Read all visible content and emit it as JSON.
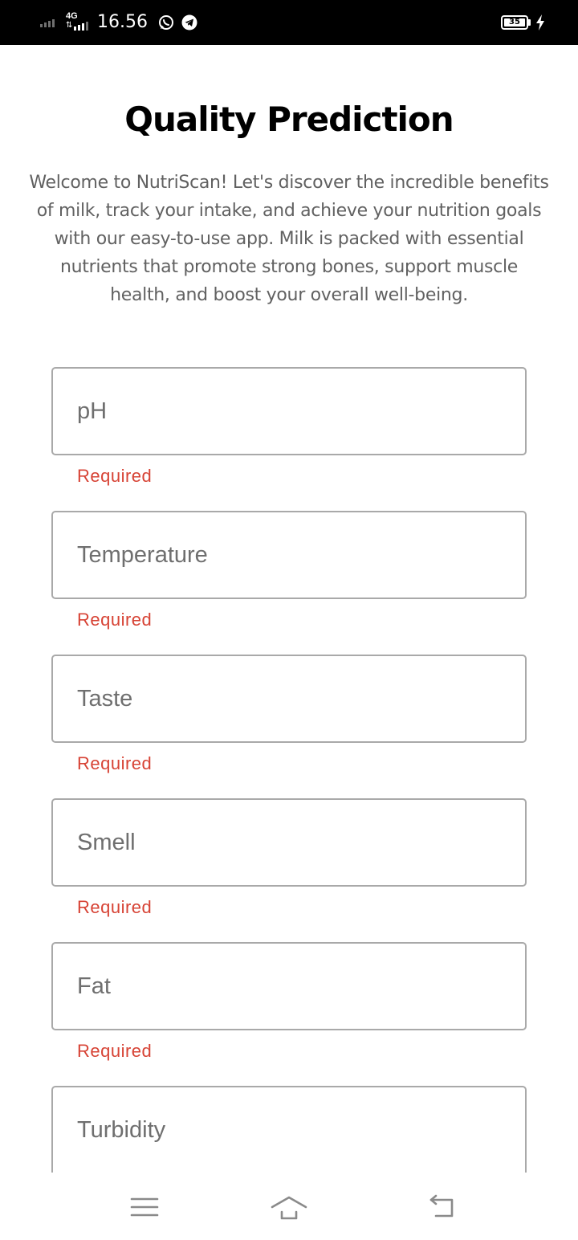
{
  "status_bar": {
    "network_type": "4G",
    "network_arrows": "⇅",
    "time": "16.56",
    "battery_level": "35",
    "icons": [
      "signal-icon",
      "network-signal-icon",
      "whatsapp-icon",
      "telegram-icon",
      "battery-icon",
      "charging-icon"
    ]
  },
  "page": {
    "title": "Quality Prediction",
    "intro": "Welcome to NutriScan! Let's discover the incredible benefits of milk, track your intake, and achieve your nutrition goals with our easy-to-use app. Milk is packed with essential nutrients that promote strong bones, support muscle health, and boost your overall well-being."
  },
  "form": {
    "fields": [
      {
        "placeholder": "pH",
        "value": "",
        "error": "Required"
      },
      {
        "placeholder": "Temperature",
        "value": "",
        "error": "Required"
      },
      {
        "placeholder": "Taste",
        "value": "",
        "error": "Required"
      },
      {
        "placeholder": "Smell",
        "value": "",
        "error": "Required"
      },
      {
        "placeholder": "Fat",
        "value": "",
        "error": "Required"
      },
      {
        "placeholder": "Turbidity",
        "value": ""
      }
    ]
  },
  "nav_bar": {
    "buttons": [
      "menu-icon",
      "home-icon",
      "back-icon"
    ]
  },
  "colors": {
    "status_bar_bg": "#000000",
    "title": "#000000",
    "body_text": "#616161",
    "field_border": "#a9a9a9",
    "error": "#d74335",
    "nav_icons": "#8a8a8a"
  }
}
